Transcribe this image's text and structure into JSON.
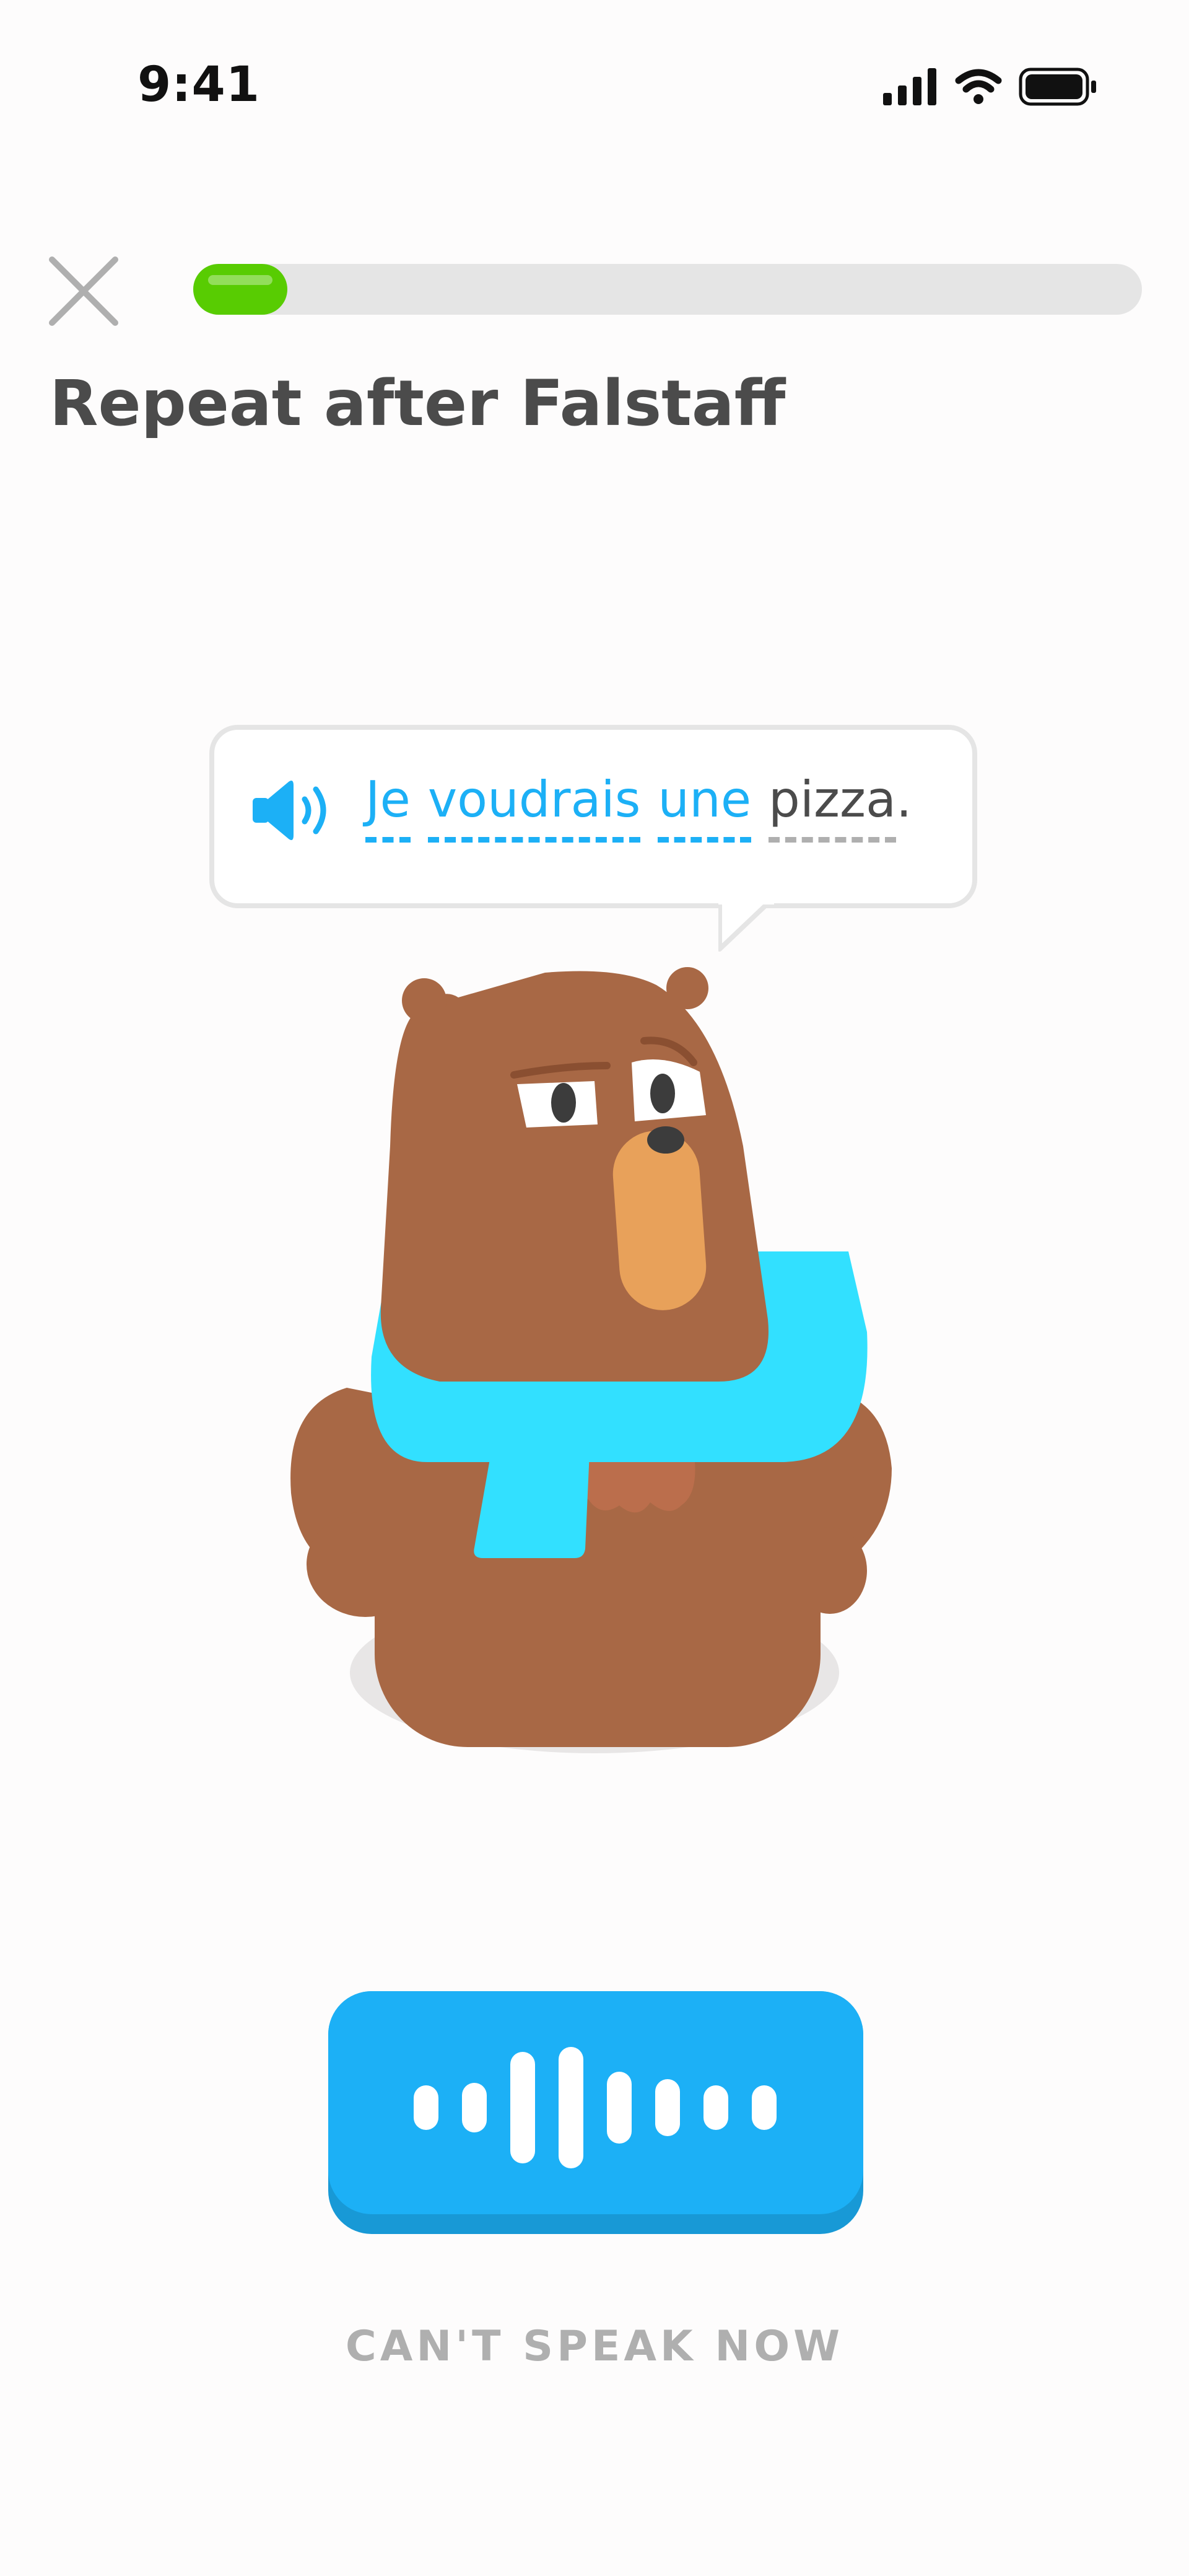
{
  "status_bar": {
    "time": "9:41",
    "icons": [
      "signal-icon",
      "wifi-icon",
      "battery-icon"
    ]
  },
  "header": {
    "close_icon": "close-icon",
    "progress": 0.035,
    "title": "Repeat after Falstaff"
  },
  "prompt": {
    "speaker_icon": "speaker-icon",
    "words": [
      {
        "text": "Je",
        "status": "known"
      },
      {
        "text": "voudrais",
        "status": "known"
      },
      {
        "text": "une",
        "status": "known"
      },
      {
        "text": "pizza",
        "status": "new"
      }
    ],
    "punctuation": "."
  },
  "character": {
    "name": "bear-character"
  },
  "actions": {
    "mic_icon": "microphone-waveform-icon",
    "cant_speak_label": "CAN'T SPEAK NOW"
  },
  "colors": {
    "accent_blue": "#1cb0f6",
    "accent_blue_shadow": "#1899d6",
    "progress_green": "#58cc02",
    "track_gray": "#e5e5e5",
    "muted_text": "#afafaf",
    "title_text": "#4b4b4b"
  }
}
